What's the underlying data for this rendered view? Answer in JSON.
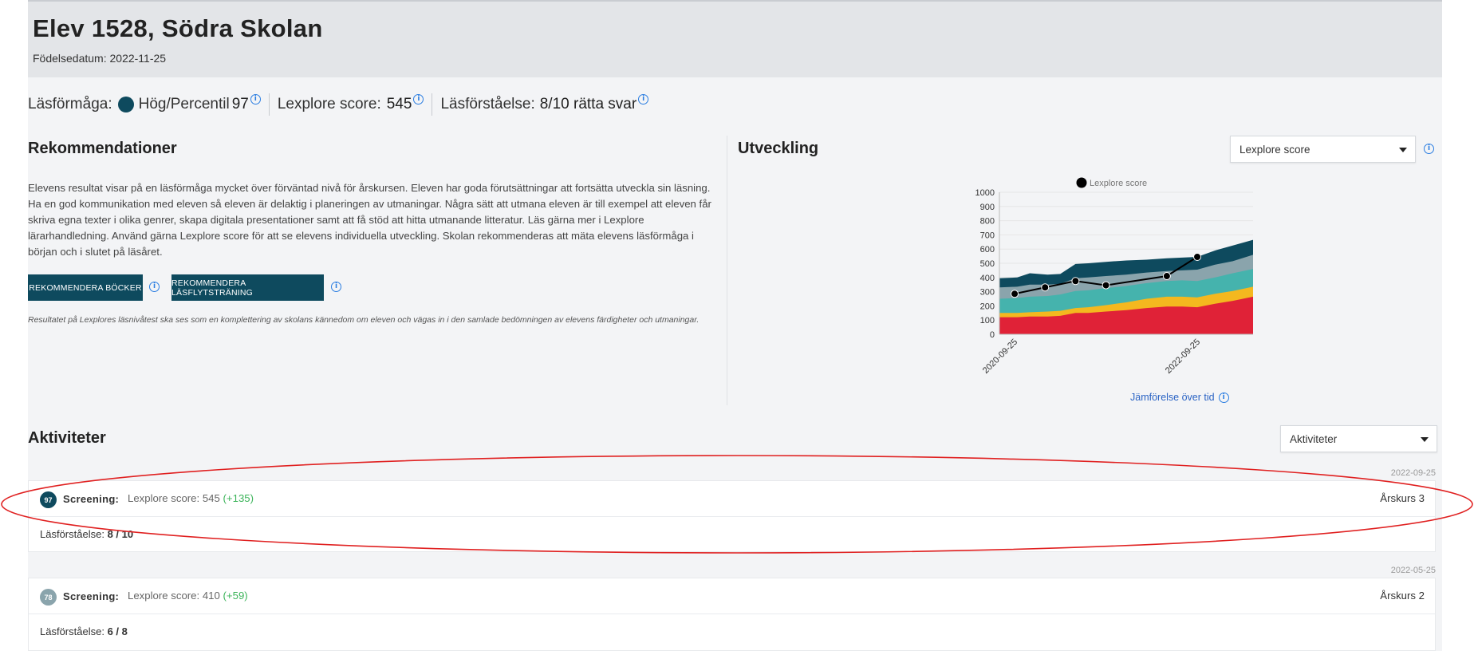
{
  "header": {
    "title": "Elev 1528, Södra Skolan",
    "dob_label": "Födelsedatum: 2022-11-25"
  },
  "summary": {
    "reading_label": "Läsförmåga:",
    "reading_level": "Hög/Percentil",
    "reading_percentile": "97",
    "lexplore_label": "Lexplore score:",
    "lexplore_value": "545",
    "comprehension_label": "Läsförståelse:",
    "comprehension_value": "8/10 rätta svar",
    "level_color": "#0e4a5e"
  },
  "recommendations": {
    "title": "Rekommendationer",
    "text": "Elevens resultat visar på en läsförmåga mycket över förväntad nivå för årskursen. Eleven har goda förutsättningar att fortsätta utveckla sin läsning. Ha en god kommunikation med eleven så eleven är delaktig i planeringen av utmaningar. Några sätt att utmana eleven är till exempel att eleven får skriva egna texter i olika genrer, skapa digitala presentationer samt att få stöd att hitta utmanande litteratur. Läs gärna mer i Lexplore lärarhandledning. Använd gärna Lexplore score för att se elevens individuella utveckling. Skolan rekommenderas att mäta elevens läsförmåga i början och i slutet på läsåret.",
    "button_books": "REKOMMENDERA BÖCKER",
    "button_fluency": "REKOMMENDERA LÄSFLYTSTRÄNING",
    "note": "Resultatet på Lexplores läsnivåtest ska ses som en komplettering av skolans kännedom om eleven och vägas in i den samlade bedömningen av elevens färdigheter och utmaningar."
  },
  "development": {
    "title": "Utveckling",
    "select_value": "Lexplore score",
    "compare_link": "Jämförelse över tid"
  },
  "chart_data": {
    "type": "area",
    "legend": [
      "Lexplore score"
    ],
    "legend_position": "top",
    "ylim": [
      0,
      1000
    ],
    "yticks": [
      0,
      100,
      200,
      300,
      400,
      500,
      600,
      700,
      800,
      900,
      1000
    ],
    "xticks": [
      "2020-09-25",
      "2022-09-25"
    ],
    "grid": true,
    "bands_x": [
      0,
      0.07,
      0.12,
      0.19,
      0.24,
      0.3,
      0.35,
      0.42,
      0.5,
      0.58,
      0.66,
      0.72,
      0.78,
      0.85,
      0.92,
      1
    ],
    "bands": [
      {
        "color": "#e02237",
        "top": [
          120,
          120,
          125,
          125,
          130,
          150,
          150,
          160,
          170,
          185,
          195,
          195,
          190,
          215,
          235,
          265
        ]
      },
      {
        "color": "#f4b81f",
        "top": [
          150,
          150,
          155,
          160,
          165,
          185,
          190,
          205,
          225,
          250,
          265,
          265,
          260,
          285,
          305,
          335
        ]
      },
      {
        "color": "#45b3ad",
        "top": [
          250,
          255,
          265,
          270,
          280,
          305,
          310,
          325,
          340,
          360,
          375,
          380,
          375,
          400,
          430,
          460
        ]
      },
      {
        "color": "#8aa4ac",
        "top": [
          330,
          335,
          350,
          350,
          355,
          395,
          400,
          410,
          420,
          435,
          445,
          450,
          455,
          490,
          515,
          560
        ]
      },
      {
        "color": "#0e4a5e",
        "top": [
          395,
          400,
          430,
          420,
          425,
          495,
          500,
          510,
          520,
          525,
          535,
          540,
          545,
          590,
          625,
          665
        ]
      }
    ],
    "series": [
      {
        "name": "Lexplore score",
        "x": [
          "2020-09-25",
          "2021-01-25",
          "2021-05-25",
          "2021-09-25",
          "2022-05-25",
          "2022-09-25"
        ],
        "x_frac": [
          0.06,
          0.18,
          0.3,
          0.42,
          0.66,
          0.78
        ],
        "values": [
          285,
          330,
          375,
          345,
          410,
          545
        ],
        "color": "#000000"
      }
    ]
  },
  "activities": {
    "title": "Aktiviteter",
    "select_value": "Aktiviteter",
    "items": [
      {
        "date": "2022-09-25",
        "badge": "97",
        "badge_color": "#0e4a5e",
        "label": "Screening:",
        "score_text": "Lexplore score: 545",
        "delta": "(+135)",
        "grade": "Årskurs 3",
        "comp_label": "Läsförståelse:",
        "comp_value": "8 / 10"
      },
      {
        "date": "2022-05-25",
        "badge": "78",
        "badge_color": "#8aa4ac",
        "label": "Screening:",
        "score_text": "Lexplore score: 410",
        "delta": "(+59)",
        "grade": "Årskurs 2",
        "comp_label": "Läsförståelse:",
        "comp_value": "6 / 8"
      }
    ]
  },
  "annotation_color": "#e02020"
}
